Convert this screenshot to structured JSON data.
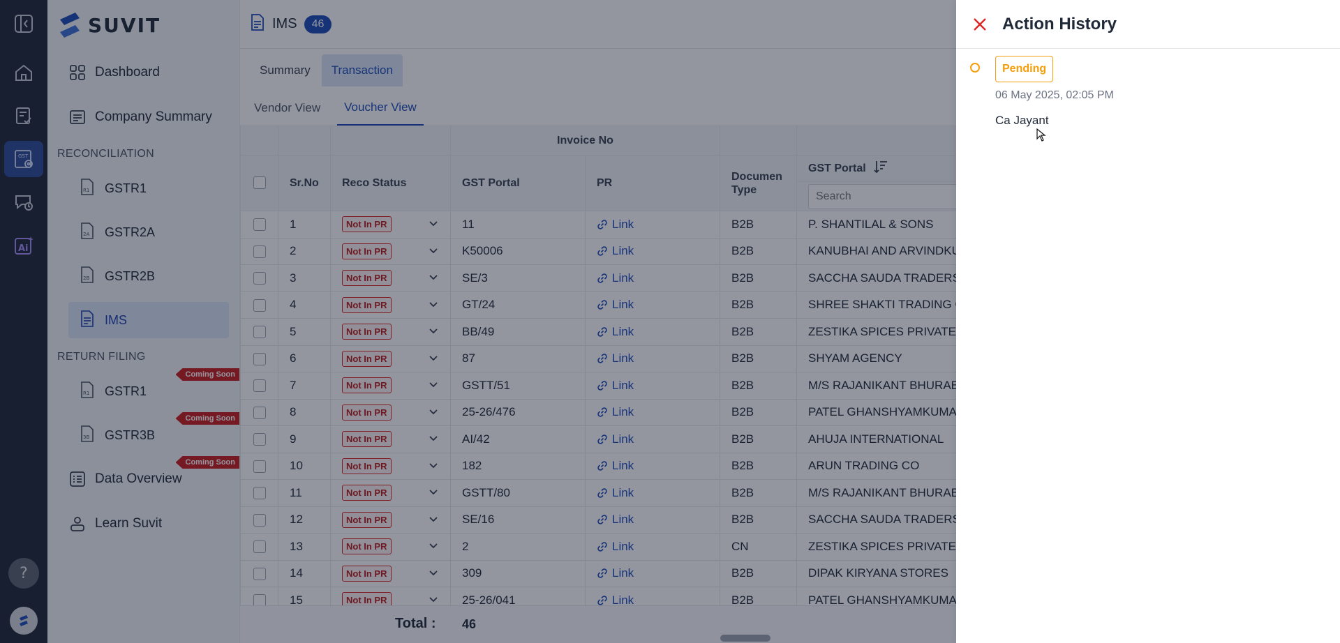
{
  "app": {
    "logo_text": "SUVIT"
  },
  "sidebar": {
    "dashboard": "Dashboard",
    "company_summary": "Company Summary",
    "reconciliation_header": "RECONCILIATION",
    "reconciliation_items": [
      "GSTR1",
      "GSTR2A",
      "GSTR2B",
      "IMS"
    ],
    "return_filing_header": "RETURN FILING",
    "return_filing_items": [
      "GSTR1",
      "GSTR3B"
    ],
    "coming_soon": "Coming Soon",
    "data_overview": "Data Overview",
    "learn": "Learn Suvit",
    "help_glyph": "?"
  },
  "header": {
    "title": "IMS",
    "count": "46"
  },
  "tabs": [
    "Summary",
    "Transaction"
  ],
  "subtabs": [
    "Vendor View",
    "Voucher View"
  ],
  "table": {
    "group_header": "Invoice No",
    "columns": {
      "srno": "Sr.No",
      "reco": "Reco Status",
      "gst_portal": "GST Portal",
      "pr": "PR",
      "doctype": "Documen Type",
      "vendor": "GST Portal"
    },
    "search_placeholder": "Search",
    "rows": [
      {
        "sr": "1",
        "status": "Not In PR",
        "inv": "11",
        "link": "Link",
        "type": "B2B",
        "vendor": "P. SHANTILAL & SONS"
      },
      {
        "sr": "2",
        "status": "Not In PR",
        "inv": "K50006",
        "link": "Link",
        "type": "B2B",
        "vendor": "KANUBHAI AND ARVINDKU"
      },
      {
        "sr": "3",
        "status": "Not In PR",
        "inv": "SE/3",
        "link": "Link",
        "type": "B2B",
        "vendor": "SACCHA SAUDA TRADERS"
      },
      {
        "sr": "4",
        "status": "Not In PR",
        "inv": "GT/24",
        "link": "Link",
        "type": "B2B",
        "vendor": "SHREE SHAKTI TRADING C"
      },
      {
        "sr": "5",
        "status": "Not In PR",
        "inv": "BB/49",
        "link": "Link",
        "type": "B2B",
        "vendor": "ZESTIKA SPICES PRIVATE L"
      },
      {
        "sr": "6",
        "status": "Not In PR",
        "inv": "87",
        "link": "Link",
        "type": "B2B",
        "vendor": "SHYAM AGENCY"
      },
      {
        "sr": "7",
        "status": "Not In PR",
        "inv": "GSTT/51",
        "link": "Link",
        "type": "B2B",
        "vendor": "M/S RAJANIKANT BHURAB"
      },
      {
        "sr": "8",
        "status": "Not In PR",
        "inv": "25-26/476",
        "link": "Link",
        "type": "B2B",
        "vendor": "PATEL GHANSHYAMKUMAR"
      },
      {
        "sr": "9",
        "status": "Not In PR",
        "inv": "AI/42",
        "link": "Link",
        "type": "B2B",
        "vendor": "AHUJA INTERNATIONAL"
      },
      {
        "sr": "10",
        "status": "Not In PR",
        "inv": "182",
        "link": "Link",
        "type": "B2B",
        "vendor": "ARUN TRADING CO"
      },
      {
        "sr": "11",
        "status": "Not In PR",
        "inv": "GSTT/80",
        "link": "Link",
        "type": "B2B",
        "vendor": "M/S RAJANIKANT BHURAB"
      },
      {
        "sr": "12",
        "status": "Not In PR",
        "inv": "SE/16",
        "link": "Link",
        "type": "B2B",
        "vendor": "SACCHA SAUDA TRADERS"
      },
      {
        "sr": "13",
        "status": "Not In PR",
        "inv": "2",
        "link": "Link",
        "type": "CN",
        "vendor": "ZESTIKA SPICES PRIVATE L"
      },
      {
        "sr": "14",
        "status": "Not In PR",
        "inv": "309",
        "link": "Link",
        "type": "B2B",
        "vendor": "DIPAK KIRYANA STORES"
      },
      {
        "sr": "15",
        "status": "Not In PR",
        "inv": "25-26/041",
        "link": "Link",
        "type": "B2B",
        "vendor": "PATEL GHANSHYAMKUMAR"
      }
    ],
    "footer": {
      "total_label": "Total :",
      "total_value": "46"
    }
  },
  "drawer": {
    "title": "Action History",
    "entries": [
      {
        "status": "Pending",
        "time": "06 May 2025, 02:05 PM",
        "user": "Ca Jayant"
      }
    ]
  },
  "colors": {
    "accent": "#1e4bb8",
    "pending": "#f59e0b",
    "danger": "#dc2626",
    "rail": "#1e2735"
  }
}
